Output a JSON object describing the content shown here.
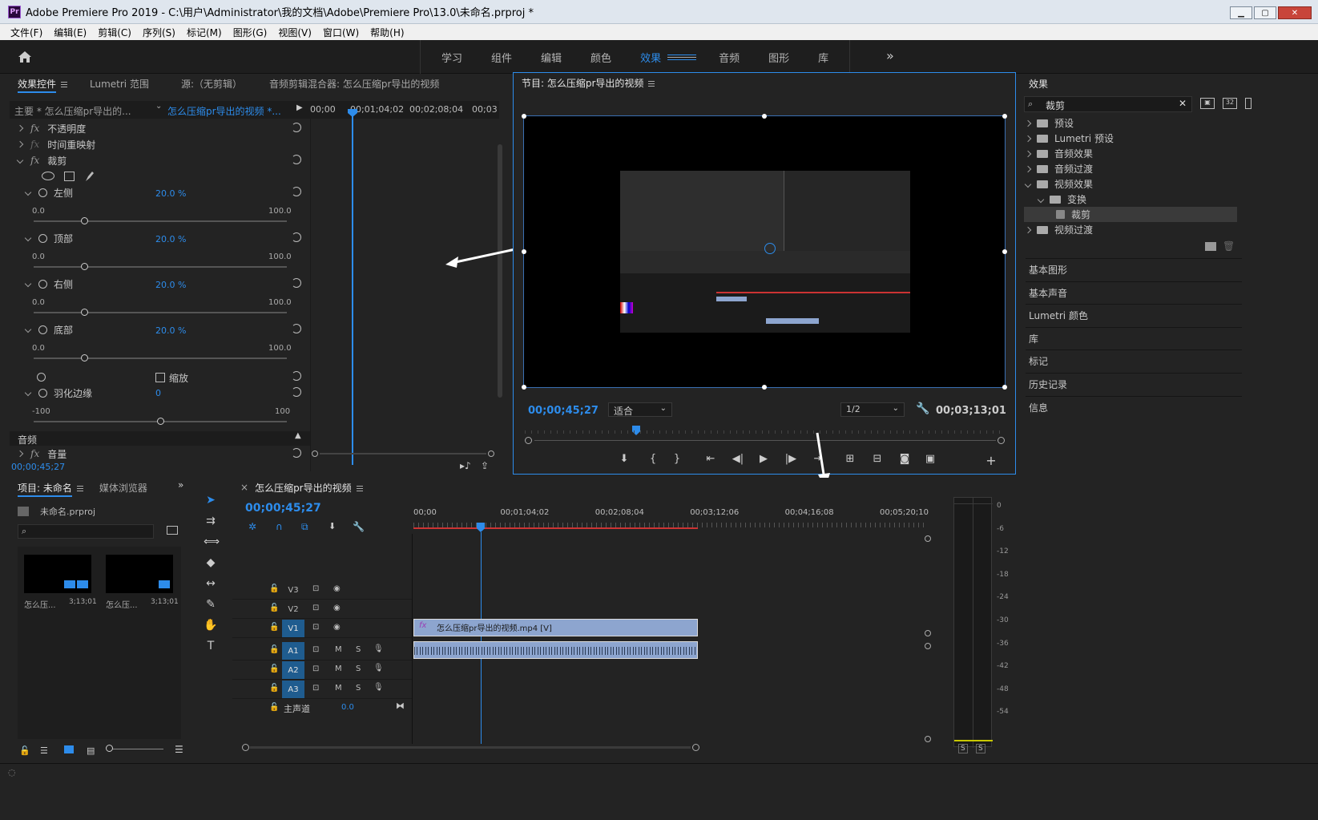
{
  "window": {
    "title": "Adobe Premiere Pro 2019 - C:\\用户\\Administrator\\我的文档\\Adobe\\Premiere Pro\\13.0\\未命名.prproj *",
    "logo": "Pr"
  },
  "menu": [
    "文件(F)",
    "编辑(E)",
    "剪辑(C)",
    "序列(S)",
    "标记(M)",
    "图形(G)",
    "视图(V)",
    "窗口(W)",
    "帮助(H)"
  ],
  "workspaces": {
    "tabs": [
      "学习",
      "组件",
      "编辑",
      "颜色",
      "效果",
      "音频",
      "图形",
      "库"
    ],
    "active": "效果",
    "more": "»"
  },
  "effect_controls": {
    "tabs": [
      "效果控件",
      "Lumetri 范围",
      "源:（无剪辑）",
      "音频剪辑混合器: 怎么压缩pr导出的视频"
    ],
    "master": "主要 * 怎么压缩pr导出的...",
    "clip": "怎么压缩pr导出的视频 *...",
    "ruler": [
      "00;00",
      "00;01;04;02",
      "00;02;08;04",
      "00;03"
    ],
    "opacity": "不透明度",
    "time_remap": "时间重映射",
    "crop": "裁剪",
    "params": [
      {
        "name": "左侧",
        "value": "20.0 %",
        "min": "0.0",
        "max": "100.0",
        "level": 0.2
      },
      {
        "name": "顶部",
        "value": "20.0 %",
        "min": "0.0",
        "max": "100.0",
        "level": 0.2
      },
      {
        "name": "右侧",
        "value": "20.0 %",
        "min": "0.0",
        "max": "100.0",
        "level": 0.2
      },
      {
        "name": "底部",
        "value": "20.0 %",
        "min": "0.0",
        "max": "100.0",
        "level": 0.2
      }
    ],
    "zoom_label": "缩放",
    "feather": {
      "name": "羽化边缘",
      "value": "0",
      "min": "-100",
      "max": "100",
      "level": 0.5
    },
    "audio": "音频",
    "volume": "音量",
    "timecode": "00;00;45;27"
  },
  "program_monitor": {
    "title": "节目: 怎么压缩pr导出的视频",
    "timecode": "00;00;45;27",
    "fit": "适合",
    "resolution": "1/2",
    "duration": "00;03;13;01"
  },
  "effects_panel": {
    "title": "效果",
    "search": "裁剪",
    "tree": [
      {
        "label": "预设",
        "depth": 0
      },
      {
        "label": "Lumetri 预设",
        "depth": 0
      },
      {
        "label": "音频效果",
        "depth": 0
      },
      {
        "label": "音频过渡",
        "depth": 0
      },
      {
        "label": "视频效果",
        "depth": 0
      },
      {
        "label": "变换",
        "depth": 1
      },
      {
        "label": "裁剪",
        "depth": 2
      },
      {
        "label": "视频过渡",
        "depth": 0
      }
    ],
    "sections": [
      "基本图形",
      "基本声音",
      "Lumetri 颜色",
      "库",
      "标记",
      "历史记录",
      "信息"
    ]
  },
  "project": {
    "tabs": [
      "项目: 未命名",
      "媒体浏览器"
    ],
    "file": "未命名.prproj",
    "items": [
      {
        "name": "怎么压...",
        "duration": "3;13;01"
      },
      {
        "name": "怎么压...",
        "duration": "3;13;01"
      }
    ]
  },
  "timeline": {
    "title": "怎么压缩pr导出的视频",
    "timecode": "00;00;45;27",
    "ruler": [
      "00;00",
      "00;01;04;02",
      "00;02;08;04",
      "00;03;12;06",
      "00;04;16;08",
      "00;05;20;10"
    ],
    "video_tracks": [
      "V3",
      "V2",
      "V1"
    ],
    "audio_tracks": [
      "A1",
      "A2",
      "A3"
    ],
    "master": "主声道",
    "master_value": "0.0",
    "clip_label": "怎么压缩pr导出的视频.mp4 [V]",
    "mute": "M",
    "solo": "S"
  },
  "meter": {
    "labels": [
      "0",
      "-6",
      "-12",
      "-18",
      "-24",
      "-30",
      "-36",
      "-42",
      "-48",
      "-54"
    ],
    "footer": [
      "S",
      "S"
    ]
  },
  "colors": {
    "accent": "#2d8ceb",
    "clip_video": "#8da5cf",
    "playhead": "#2d8ceb"
  }
}
